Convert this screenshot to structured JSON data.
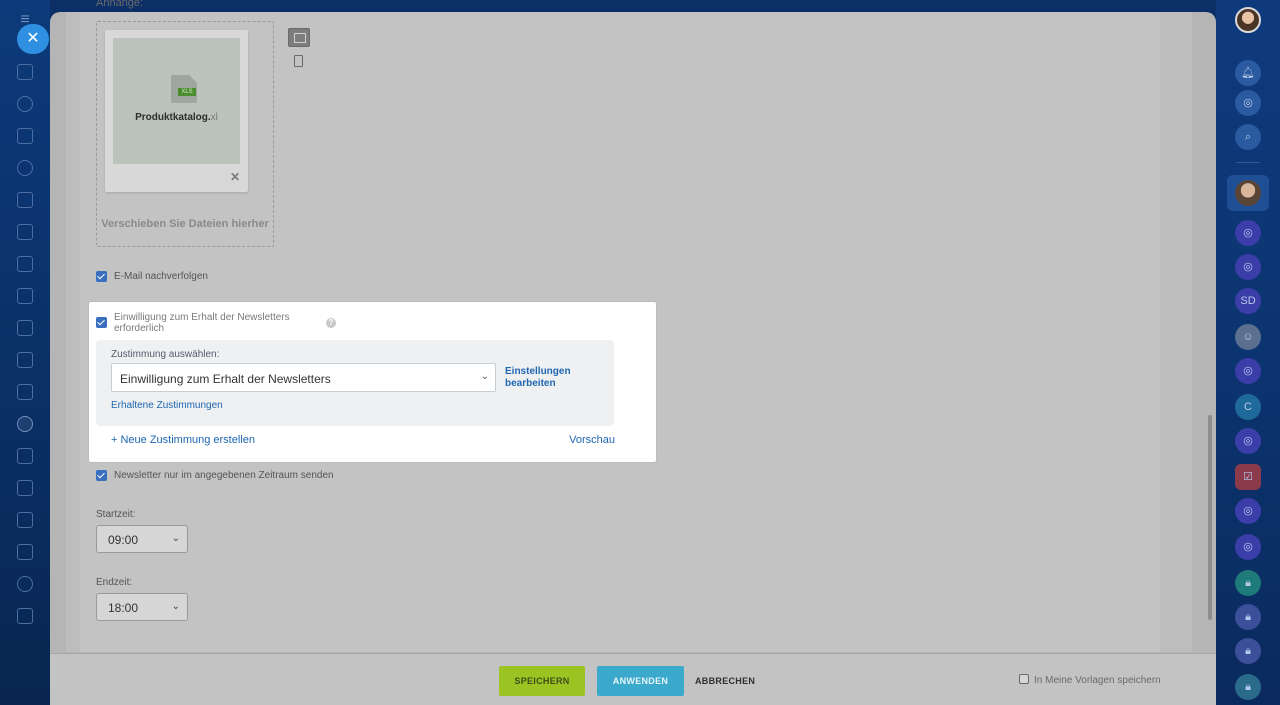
{
  "left_sidebar": {
    "menu_icon": "hamburger-icon",
    "close_icon": "close-icon",
    "nav_icons": [
      "home-icon",
      "activity-icon",
      "feed-icon",
      "contacts-icon",
      "document-icon",
      "print-icon",
      "monitor-icon",
      "tasks-icon",
      "chat-icon",
      "chart-icon",
      "cart-icon",
      "marketing-icon",
      "database-icon",
      "filter-icon",
      "mail-icon",
      "group-icon",
      "globe-icon",
      "table-icon"
    ]
  },
  "attachments": {
    "label": "Anhänge:",
    "file_name": "Produktkatalog.",
    "file_ext": "xl",
    "file_badge": "XLS",
    "remove_symbol": "✕",
    "drop_text": "Verschieben Sie Dateien hierher"
  },
  "track_email": {
    "label": "E-Mail nachverfolgen",
    "checked": true
  },
  "consent": {
    "label": "Einwilligung zum Erhalt der Newsletters erforderlich",
    "checked": true,
    "help": "?",
    "select_label": "Zustimmung auswählen:",
    "selected_value": "Einwilligung zum Erhalt der Newsletters",
    "chevron": "⌄",
    "settings_link_line1": "Einstellungen",
    "settings_link_line2": "bearbeiten",
    "received_link": "Erhaltene Zustimmungen",
    "new_link": "+ Neue Zustimmung erstellen",
    "preview_link": "Vorschau"
  },
  "period": {
    "label": "Newsletter nur im angegebenen Zeitraum senden",
    "checked": true,
    "start_label": "Startzeit:",
    "start_value": "09:00",
    "end_label": "Endzeit:",
    "end_value": "18:00"
  },
  "footer": {
    "save": "SPEICHERN",
    "apply": "ANWENDEN",
    "cancel": "ABBRECHEN",
    "template_label": "In Meine Vorlagen speichern"
  },
  "right_sidebar": {
    "items": [
      "avatar",
      "bell-icon",
      "target-icon",
      "search-chat-icon",
      "avatar",
      "openline-icon",
      "openline-icon",
      "SD",
      "robot-avatar",
      "openline-icon",
      "C",
      "openline-icon",
      "task-icon",
      "openline-icon",
      "openline-icon",
      "lock-icon",
      "lock-icon",
      "lock-icon",
      "lock-icon"
    ],
    "sd_text": "SD",
    "c_text": "C"
  },
  "colors": {
    "accent_blue": "#2067b0",
    "save_green": "#9bc423",
    "apply_blue": "#3ba9cc",
    "sidebar_blue": "#0c3a7a"
  }
}
